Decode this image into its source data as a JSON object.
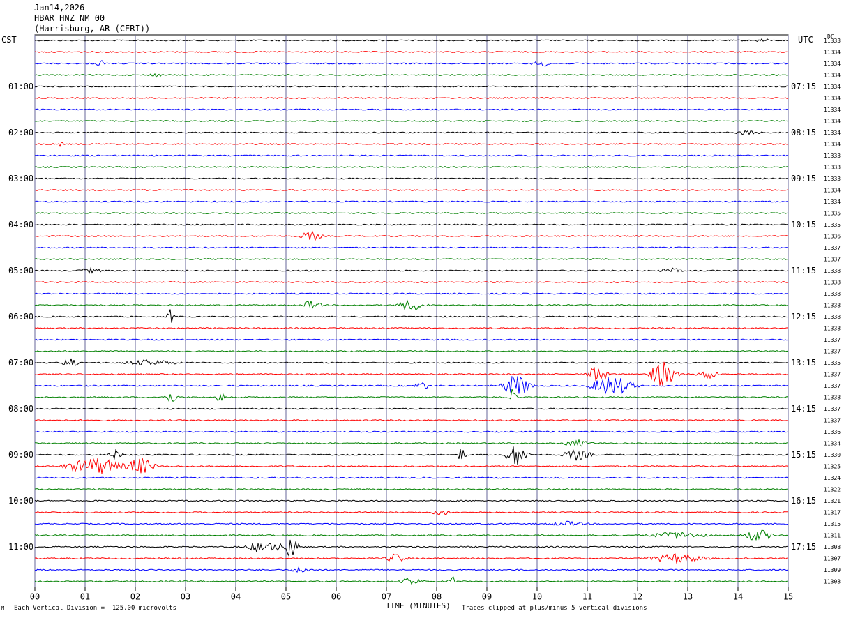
{
  "header": {
    "date": "Jan14,2026",
    "station": "HBAR HNZ NM 00",
    "location": "(Harrisburg, AR (CERI))"
  },
  "labels": {
    "left_timezone": "CST",
    "right_timezone": "UTC",
    "dc_header": "DC",
    "x_axis_title": "TIME (MINUTES)",
    "scale_note": "Each Vertical Division =  125.00 microvolts",
    "clip_note": "Traces clipped at plus/minus 5 vertical divisions",
    "corner_mark": "M"
  },
  "colors": {
    "trace_cycle": [
      "#000000",
      "#ff0000",
      "#0000ff",
      "#008000"
    ],
    "grid": "#666699"
  },
  "chart_data": {
    "type": "line",
    "title": "",
    "xlabel": "TIME (MINUTES)",
    "x_ticks": [
      "00",
      "01",
      "02",
      "03",
      "04",
      "05",
      "06",
      "07",
      "08",
      "09",
      "10",
      "11",
      "12",
      "13",
      "14",
      "15"
    ],
    "xlim": [
      0,
      15
    ],
    "trace_count": 48,
    "minutes_per_trace": 15,
    "left_time_labels": [
      {
        "trace": 4,
        "label": "01:00"
      },
      {
        "trace": 8,
        "label": "02:00"
      },
      {
        "trace": 12,
        "label": "03:00"
      },
      {
        "trace": 16,
        "label": "04:00"
      },
      {
        "trace": 20,
        "label": "05:00"
      },
      {
        "trace": 24,
        "label": "06:00"
      },
      {
        "trace": 28,
        "label": "07:00"
      },
      {
        "trace": 32,
        "label": "08:00"
      },
      {
        "trace": 36,
        "label": "09:00"
      },
      {
        "trace": 40,
        "label": "10:00"
      },
      {
        "trace": 44,
        "label": "11:00"
      }
    ],
    "right_time_labels": [
      {
        "trace": 4,
        "label": "07:15"
      },
      {
        "trace": 8,
        "label": "08:15"
      },
      {
        "trace": 12,
        "label": "09:15"
      },
      {
        "trace": 16,
        "label": "10:15"
      },
      {
        "trace": 20,
        "label": "11:15"
      },
      {
        "trace": 24,
        "label": "12:15"
      },
      {
        "trace": 28,
        "label": "13:15"
      },
      {
        "trace": 32,
        "label": "14:15"
      },
      {
        "trace": 36,
        "label": "15:15"
      },
      {
        "trace": 40,
        "label": "16:15"
      },
      {
        "trace": 44,
        "label": "17:15"
      }
    ],
    "dc_offsets": [
      "11333",
      "11334",
      "11334",
      "11334",
      "11334",
      "11334",
      "11334",
      "11334",
      "11334",
      "11334",
      "11333",
      "11333",
      "11333",
      "11334",
      "11334",
      "11335",
      "11335",
      "11336",
      "11337",
      "11337",
      "11338",
      "11338",
      "11338",
      "11338",
      "11338",
      "11338",
      "11337",
      "11337",
      "11335",
      "11337",
      "11337",
      "11338",
      "11337",
      "11337",
      "11336",
      "11334",
      "11330",
      "11325",
      "11324",
      "11322",
      "11321",
      "11317",
      "11315",
      "11311",
      "11308",
      "11307",
      "11309",
      "11308"
    ],
    "bursts": [
      {
        "trace": 0,
        "minute": 14.5,
        "amp": 4,
        "width": 0.2
      },
      {
        "trace": 2,
        "minute": 1.3,
        "amp": 8,
        "width": 0.1
      },
      {
        "trace": 2,
        "minute": 10.1,
        "amp": 5,
        "width": 0.3
      },
      {
        "trace": 3,
        "minute": 2.4,
        "amp": 4,
        "width": 0.2
      },
      {
        "trace": 8,
        "minute": 14.2,
        "amp": 4,
        "width": 0.4
      },
      {
        "trace": 9,
        "minute": 0.5,
        "amp": 4,
        "width": 0.1
      },
      {
        "trace": 17,
        "minute": 5.5,
        "amp": 8,
        "width": 0.3
      },
      {
        "trace": 20,
        "minute": 1.1,
        "amp": 4,
        "width": 0.4
      },
      {
        "trace": 20,
        "minute": 12.7,
        "amp": 4,
        "width": 0.4
      },
      {
        "trace": 23,
        "minute": 5.5,
        "amp": 7,
        "width": 0.3
      },
      {
        "trace": 23,
        "minute": 7.5,
        "amp": 9,
        "width": 0.4
      },
      {
        "trace": 24,
        "minute": 2.7,
        "amp": 12,
        "width": 0.1
      },
      {
        "trace": 28,
        "minute": 0.7,
        "amp": 9,
        "width": 0.2
      },
      {
        "trace": 28,
        "minute": 2.3,
        "amp": 5,
        "width": 0.8
      },
      {
        "trace": 29,
        "minute": 11.2,
        "amp": 14,
        "width": 0.3
      },
      {
        "trace": 29,
        "minute": 12.5,
        "amp": 20,
        "width": 0.4
      },
      {
        "trace": 29,
        "minute": 13.4,
        "amp": 8,
        "width": 0.3
      },
      {
        "trace": 30,
        "minute": 9.6,
        "amp": 18,
        "width": 0.4
      },
      {
        "trace": 30,
        "minute": 11.5,
        "amp": 16,
        "width": 0.6
      },
      {
        "trace": 30,
        "minute": 7.7,
        "amp": 8,
        "width": 0.2
      },
      {
        "trace": 31,
        "minute": 2.7,
        "amp": 10,
        "width": 0.2
      },
      {
        "trace": 31,
        "minute": 3.7,
        "amp": 12,
        "width": 0.1
      },
      {
        "trace": 31,
        "minute": 9.5,
        "amp": 18,
        "width": 0.1
      },
      {
        "trace": 35,
        "minute": 10.8,
        "amp": 6,
        "width": 0.4
      },
      {
        "trace": 36,
        "minute": 1.6,
        "amp": 8,
        "width": 0.2
      },
      {
        "trace": 36,
        "minute": 8.5,
        "amp": 15,
        "width": 0.1
      },
      {
        "trace": 36,
        "minute": 9.6,
        "amp": 18,
        "width": 0.3
      },
      {
        "trace": 36,
        "minute": 10.8,
        "amp": 9,
        "width": 0.4
      },
      {
        "trace": 37,
        "minute": 1.2,
        "amp": 14,
        "width": 0.8
      },
      {
        "trace": 37,
        "minute": 2.1,
        "amp": 14,
        "width": 0.4
      },
      {
        "trace": 41,
        "minute": 8.1,
        "amp": 5,
        "width": 0.3
      },
      {
        "trace": 42,
        "minute": 10.6,
        "amp": 4,
        "width": 0.6
      },
      {
        "trace": 43,
        "minute": 14.4,
        "amp": 10,
        "width": 0.4
      },
      {
        "trace": 43,
        "minute": 12.8,
        "amp": 6,
        "width": 0.8
      },
      {
        "trace": 44,
        "minute": 5.1,
        "amp": 20,
        "width": 0.2
      },
      {
        "trace": 44,
        "minute": 4.5,
        "amp": 10,
        "width": 0.4
      },
      {
        "trace": 44,
        "minute": 4.8,
        "amp": 9,
        "width": 0.2
      },
      {
        "trace": 45,
        "minute": 7.2,
        "amp": 8,
        "width": 0.3
      },
      {
        "trace": 45,
        "minute": 12.8,
        "amp": 8,
        "width": 0.8
      },
      {
        "trace": 46,
        "minute": 5.3,
        "amp": 5,
        "width": 0.3
      },
      {
        "trace": 47,
        "minute": 7.5,
        "amp": 7,
        "width": 0.3
      },
      {
        "trace": 47,
        "minute": 8.3,
        "amp": 10,
        "width": 0.1
      }
    ]
  }
}
